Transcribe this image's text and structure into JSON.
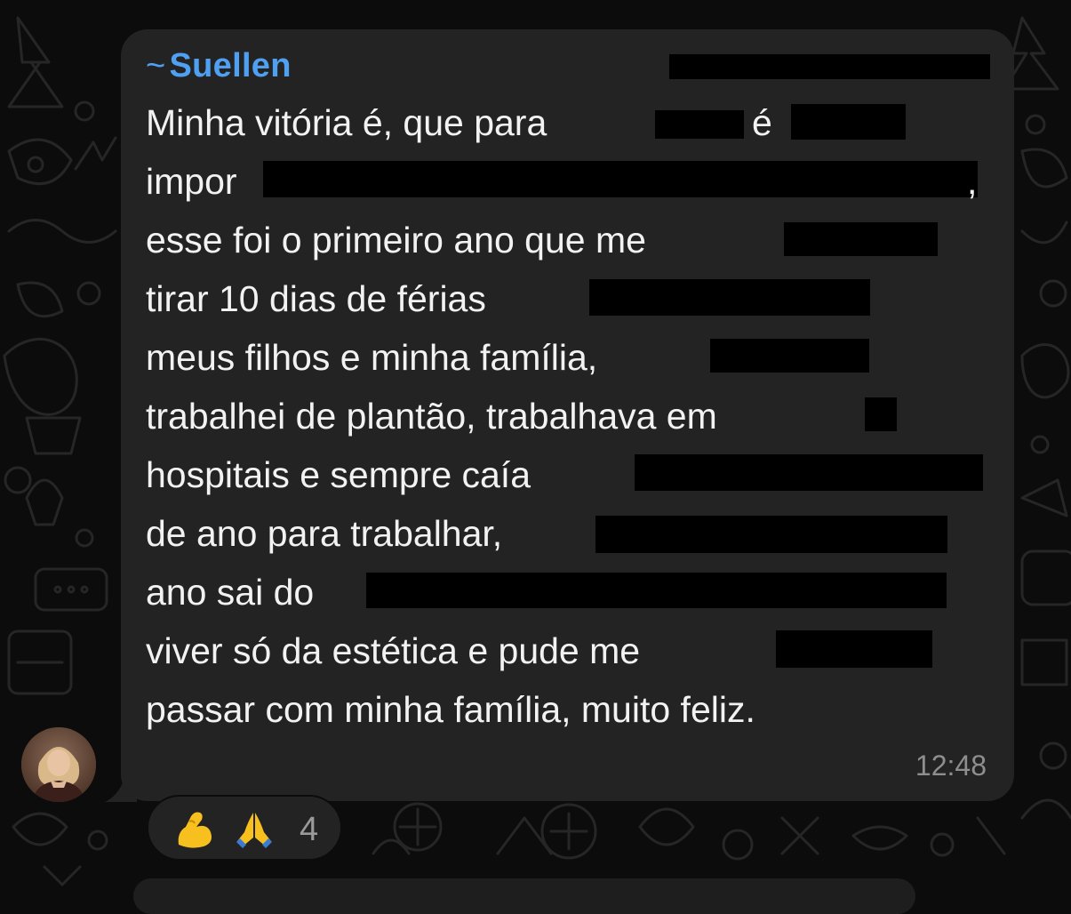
{
  "message": {
    "sender_prefix": "~",
    "sender_name": "Suellen",
    "lines": [
      "Minha vitória é, que para",
      "impor",
      "esse foi o primeiro ano que me",
      "tirar 10 dias de férias",
      "meus filhos e minha família,",
      "trabalhei de plantão, trabalhava em",
      "hospitais e sempre caía",
      "de ano para trabalhar,",
      "ano sai do",
      "viver só da estética e pude me",
      "passar com minha família, muito feliz."
    ],
    "inline_fragments": {
      "line1_e": "é",
      "line2_comma": ","
    },
    "time": "12:48"
  },
  "reactions": {
    "emojis": [
      "flexed-biceps-emoji",
      "folded-hands-emoji"
    ],
    "count": "4"
  },
  "colors": {
    "background": "#0c0c0c",
    "bubble": "#232323",
    "sender": "#4fa0f0",
    "text": "#f2f2f2",
    "time": "#8e8e8e",
    "redaction": "#000000"
  }
}
